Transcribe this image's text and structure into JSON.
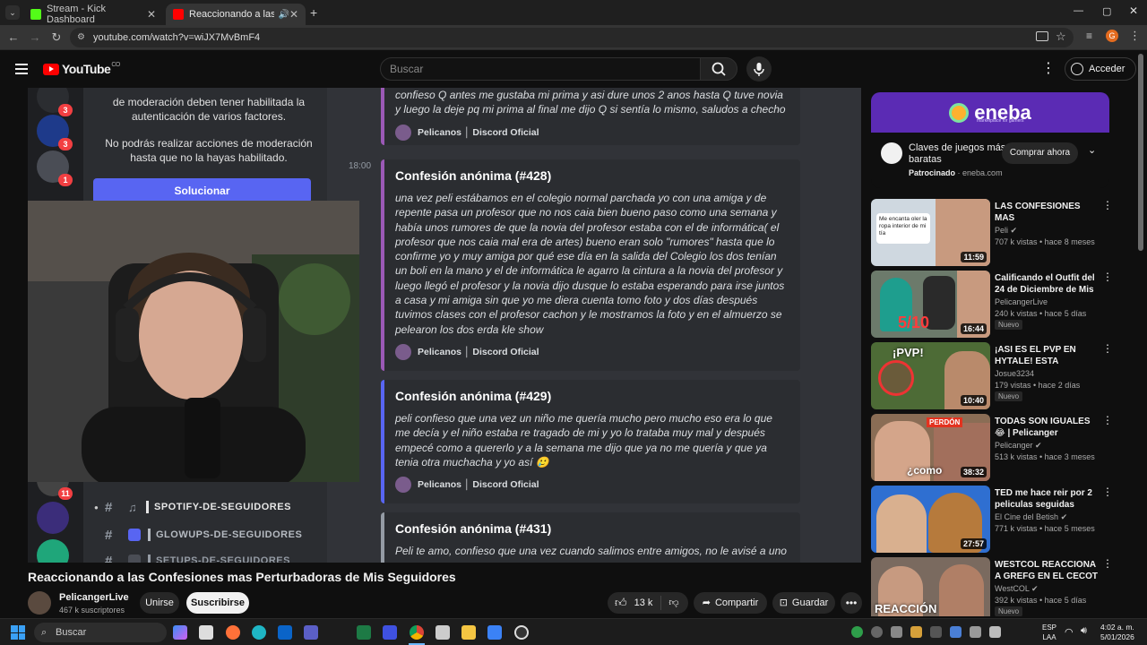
{
  "browser": {
    "tabs": [
      {
        "label": "Stream - Kick Dashboard"
      },
      {
        "label": "Reaccionando a las Confesi"
      }
    ],
    "url": "youtube.com/watch?v=wiJX7MvBmF4",
    "profile_initial": "G"
  },
  "youtube": {
    "logo_text": "YouTube",
    "logo_sup": "CO",
    "search_placeholder": "Buscar",
    "signin_label": "Acceder"
  },
  "player": {
    "discord": {
      "server_badges": [
        "3",
        "3",
        "1",
        "11"
      ],
      "mod_notice_1": "de moderación deben tener habilitada la autenticación de varios factores.",
      "mod_notice_2": "No podrás realizar acciones de moderación hasta que no la hayas habilitado.",
      "fix_button": "Solucionar",
      "channels": [
        {
          "name": "SPOTIFY-DE-SEGUIDORES"
        },
        {
          "name": "GLOWUPS-DE-SEGUIDORES"
        },
        {
          "name": "SETUPS-DE-SEGUIDORES"
        }
      ],
      "timestamp": "18:00",
      "footer_label": "Pelicanos │ Discord Oficial",
      "top_partial_text": "confieso Q antes me gustaba mi prima y asi dure unos 2 anos hasta Q tuve novia y luego la deje pq mi prima al final me dijo Q si sentía lo mismo, saludos a checho",
      "confessions": [
        {
          "title": "Confesión anónima (#428)",
          "body": "una vez peli estábamos en el colegio normal parchada yo con una amiga y de repente pasa un profesor que no nos caia bien bueno paso como una semana y había unos rumores de que la novia del profesor estaba con el de informática( el profesor que nos caia mal era de artes) bueno eran solo \"rumores\" hasta que lo confirme yo y muy amiga por qué ese día en la salida del Colegio los dos tenían un boli en la mano y el de informática le agarro la cintura a la novia del profesor y luego llegó el profesor y la novia dijo dusque lo estaba esperando para irse juntos a casa y mi amiga sin que yo me diera cuenta tomo foto y dos días después tuvimos clases con el profesor cachon y le mostramos la foto y en el almuerzo se pelearon los dos erda kle show"
        },
        {
          "title": "Confesión anónima (#429)",
          "body": "peli confieso que una vez un niño me quería mucho pero mucho eso era lo que me decía y el niño estaba re tragado de mi y yo lo trataba muy mal y después empecé como a quererlo y a la semana me dijo que ya no me quería y que ya tenia otra muchacha y yo así 🥲"
        },
        {
          "title": "Confesión anónima (#431)",
          "body": "Peli te amo, confieso que una vez cuando salimos entre amigos, no le avisé a uno"
        }
      ]
    }
  },
  "video": {
    "title": "Reaccionando a las Confesiones mas Perturbadoras de Mis Seguidores",
    "channel_name": "PelicangerLive",
    "subscribers": "467 k suscriptores",
    "join_label": "Unirse",
    "subscribe_label": "Suscribirse",
    "likes": "13 k",
    "share_label": "Compartir",
    "save_label": "Guardar"
  },
  "ad": {
    "brand": "eneba",
    "brand_sub": "marketplace for gamers",
    "text": "Claves de juegos más baratas",
    "sponsored": "Patrocinado",
    "domain": "eneba.com",
    "cta": "Comprar ahora"
  },
  "recommendations": [
    {
      "title": "LAS CONFESIONES MAS PERTURBADORAS DE MI...",
      "channel": "Peli",
      "meta": "707 k vistas • hace 8 meses",
      "duration": "11:59",
      "badge": "",
      "thumb_text": "Me encanta oler la ropa interior de mi tía"
    },
    {
      "title": "Calificando el Outfit del 24 de Diciembre de Mis ...",
      "channel": "PelicangerLive",
      "meta": "240 k vistas • hace 5 días",
      "duration": "16:44",
      "badge": "Nuevo",
      "thumb_text": "5/10"
    },
    {
      "title": "¡ASI ES EL PVP EN HYTALE! ESTA INCREIBLE",
      "channel": "Josue3234",
      "meta": "179 vistas • hace 2 días",
      "duration": "10:40",
      "badge": "Nuevo",
      "thumb_text": "¡PVP!"
    },
    {
      "title": "TODAS SON IGUALES 😂 | Pelicanger reaccionand...",
      "channel": "Pelicanger",
      "meta": "513 k vistas • hace 3 meses",
      "duration": "38:32",
      "badge": "",
      "thumb_text": "¿como"
    },
    {
      "title": "TED me hace reir por 2 peliculas seguidas",
      "channel": "El Cine del Betish",
      "meta": "771 k vistas • hace 5 meses",
      "duration": "27:57",
      "badge": "",
      "thumb_text": ""
    },
    {
      "title": "WESTCOL REACCIONA A GREFG EN EL CECOT",
      "channel": "WestCOL",
      "meta": "392 k vistas • hace 5 días",
      "duration": "",
      "badge": "Nuevo",
      "thumb_text": "REACCIÓN"
    }
  ],
  "taskbar": {
    "search_label": "Buscar",
    "lang_1": "ESP",
    "lang_2": "LAA",
    "time": "4:02 a. m.",
    "date": "5/01/2026"
  },
  "colors": {
    "yt_red": "#ff0000",
    "discord_blurple": "#5865f2",
    "embed_accent": "#9b59b6",
    "eneba_purple": "#5b2bb4"
  }
}
